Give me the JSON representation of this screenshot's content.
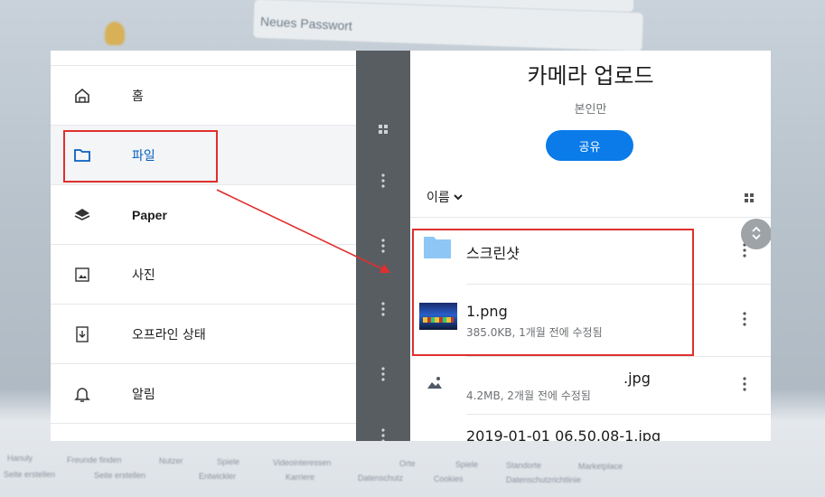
{
  "background": {
    "password_placeholder": "Neues Passwort",
    "footer_links_row1": [
      "Hanuly",
      "Freunde finden",
      "Nutzer",
      "Spiele",
      "Videointeressen",
      "Orte",
      "Spiele",
      "Standorte",
      "Marketplace"
    ],
    "footer_links_row2": [
      "Seite erstellen",
      "Seite erstellen",
      "Entwickler",
      "Karriere",
      "Datenschutz",
      "Cookies",
      "Datenschutzrichtlinie"
    ]
  },
  "sidebar": {
    "items": [
      {
        "label": "홈",
        "icon": "home-icon"
      },
      {
        "label": "파일",
        "icon": "folder-icon"
      },
      {
        "label": "Paper",
        "icon": "layers-icon"
      },
      {
        "label": "사진",
        "icon": "photo-icon"
      },
      {
        "label": "오프라인 상태",
        "icon": "offline-icon"
      },
      {
        "label": "알림",
        "icon": "bell-icon"
      }
    ]
  },
  "folder": {
    "title": "카메라 업로드",
    "subtitle": "본인만",
    "share_label": "공유",
    "sort_label": "이름",
    "files": [
      {
        "name": "스크린샷",
        "meta": ""
      },
      {
        "name": "1.png",
        "meta": "385.0KB, 1개월 전에 수정됨"
      },
      {
        "name": ".jpg",
        "meta": "4.2MB, 2개월 전에 수정됨"
      },
      {
        "name": "2019-01-01 06.50.08-1.jpg",
        "meta": ""
      }
    ]
  },
  "colors": {
    "accent": "#0a7be9",
    "annotation": "#e02f2f",
    "folder": "#8ec7f5",
    "mid_panel": "#585d62"
  }
}
